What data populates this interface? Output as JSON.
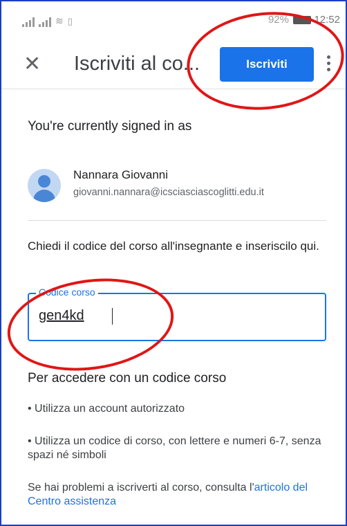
{
  "status_bar": {
    "battery_text": "92%",
    "time": "12:52"
  },
  "appbar": {
    "close_icon": "close-icon",
    "title": "Iscriviti al co...",
    "join_label": "Iscriviti",
    "more_icon": "more-vert-icon"
  },
  "account": {
    "heading": "You're currently signed in as",
    "name": "Nannara Giovanni",
    "email": "giovanni.nannara@icsciasciascoglitti.edu.it"
  },
  "form": {
    "instruction": "Chiedi il codice del corso all'insegnante e inseriscilo qui.",
    "code_label": "Codice corso",
    "code_value": "gen4kd"
  },
  "help": {
    "heading": "Per accedere con un codice corso",
    "bullet_1": "• Utilizza un account autorizzato",
    "bullet_2": "• Utilizza un codice di corso, con lettere e numeri 6-7, senza spazi né simboli",
    "trouble_text": "Se hai problemi a iscriverti al corso, consulta l'",
    "trouble_link": "articolo del Centro assistenza"
  },
  "colors": {
    "accent": "#1a73e8",
    "annotation": "#e01616",
    "frame": "#1a3fc4"
  }
}
